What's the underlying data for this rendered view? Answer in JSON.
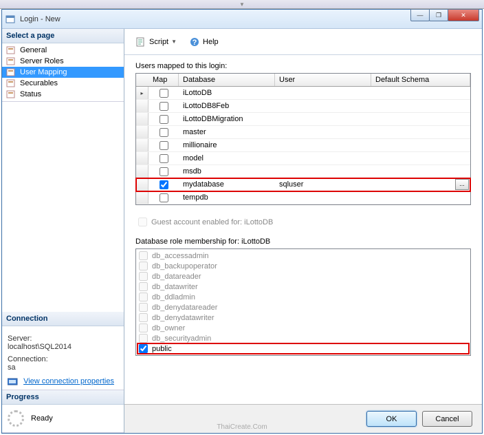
{
  "window": {
    "title": "Login - New"
  },
  "winbuttons": {
    "min": "—",
    "max": "❐",
    "close": "✕"
  },
  "sidebar": {
    "select_page": "Select a page",
    "pages": [
      {
        "label": "General"
      },
      {
        "label": "Server Roles"
      },
      {
        "label": "User Mapping"
      },
      {
        "label": "Securables"
      },
      {
        "label": "Status"
      }
    ],
    "connection_head": "Connection",
    "server_label": "Server:",
    "server_value": "localhost\\SQL2014",
    "connection_label": "Connection:",
    "connection_value": "sa",
    "view_props": "View connection properties",
    "progress_head": "Progress",
    "progress_status": "Ready"
  },
  "toolbar": {
    "script": "Script",
    "help": "Help"
  },
  "main": {
    "users_mapped_label": "Users mapped to this login:",
    "grid_headers": {
      "map": "Map",
      "database": "Database",
      "user": "User",
      "default_schema": "Default Schema"
    },
    "rows": [
      {
        "checked": false,
        "database": "iLottoDB",
        "user": "",
        "selected": true
      },
      {
        "checked": false,
        "database": "iLottoDB8Feb",
        "user": ""
      },
      {
        "checked": false,
        "database": "iLottoDBMigration",
        "user": ""
      },
      {
        "checked": false,
        "database": "master",
        "user": ""
      },
      {
        "checked": false,
        "database": "millionaire",
        "user": ""
      },
      {
        "checked": false,
        "database": "model",
        "user": ""
      },
      {
        "checked": false,
        "database": "msdb",
        "user": ""
      },
      {
        "checked": true,
        "database": "mydatabase",
        "user": "sqluser",
        "highlight": true,
        "ellipsis": true
      },
      {
        "checked": false,
        "database": "tempdb",
        "user": ""
      }
    ],
    "guest_label": "Guest account enabled for: iLottoDB",
    "roles_label": "Database role membership for: iLottoDB",
    "roles": [
      {
        "label": "db_accessadmin",
        "checked": false,
        "enabled": false
      },
      {
        "label": "db_backupoperator",
        "checked": false,
        "enabled": false
      },
      {
        "label": "db_datareader",
        "checked": false,
        "enabled": false
      },
      {
        "label": "db_datawriter",
        "checked": false,
        "enabled": false
      },
      {
        "label": "db_ddladmin",
        "checked": false,
        "enabled": false
      },
      {
        "label": "db_denydatareader",
        "checked": false,
        "enabled": false
      },
      {
        "label": "db_denydatawriter",
        "checked": false,
        "enabled": false
      },
      {
        "label": "db_owner",
        "checked": false,
        "enabled": false
      },
      {
        "label": "db_securityadmin",
        "checked": false,
        "enabled": false
      },
      {
        "label": "public",
        "checked": true,
        "enabled": true,
        "highlight": true
      }
    ]
  },
  "footer": {
    "ok": "OK",
    "cancel": "Cancel"
  },
  "watermark": "ThaiCreate.Com"
}
